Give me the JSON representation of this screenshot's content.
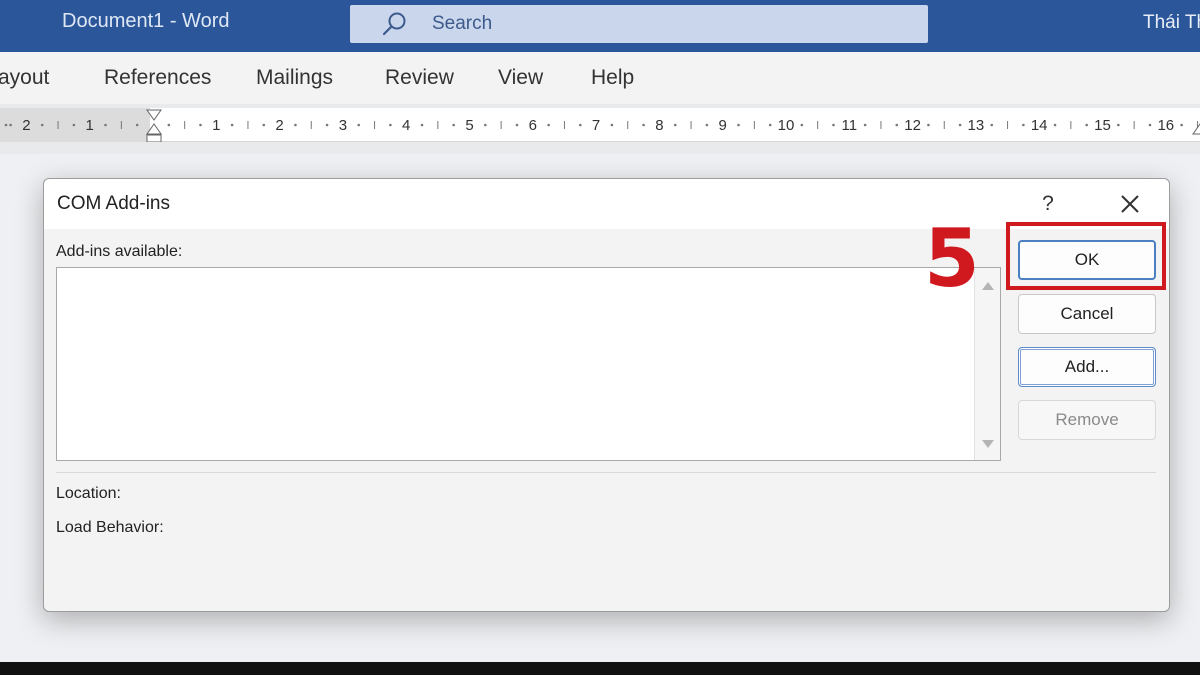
{
  "titlebar": {
    "document_title": "Document1  -  Word",
    "search_placeholder": "Search",
    "user_name": "Thái Th",
    "color": "#2b579a"
  },
  "ribbon": {
    "tabs": [
      {
        "label": "ayout"
      },
      {
        "label": "References"
      },
      {
        "label": "Mailings"
      },
      {
        "label": "Review"
      },
      {
        "label": "View"
      },
      {
        "label": "Help"
      }
    ]
  },
  "ruler": {
    "left_numbers": [
      "2",
      "1"
    ],
    "numbers": [
      "1",
      "2",
      "3",
      "4",
      "5",
      "6",
      "7",
      "8",
      "9",
      "10",
      "11",
      "12",
      "13",
      "14",
      "15",
      "16"
    ]
  },
  "dialog": {
    "title": "COM Add-ins",
    "help_label": "?",
    "addins_label": "Add-ins available:",
    "location_label": "Location:",
    "load_behavior_label": "Load Behavior:",
    "buttons": {
      "ok": "OK",
      "cancel": "Cancel",
      "add": "Add...",
      "remove": "Remove"
    }
  },
  "annotation": {
    "step": "5",
    "color": "#d0191f"
  }
}
